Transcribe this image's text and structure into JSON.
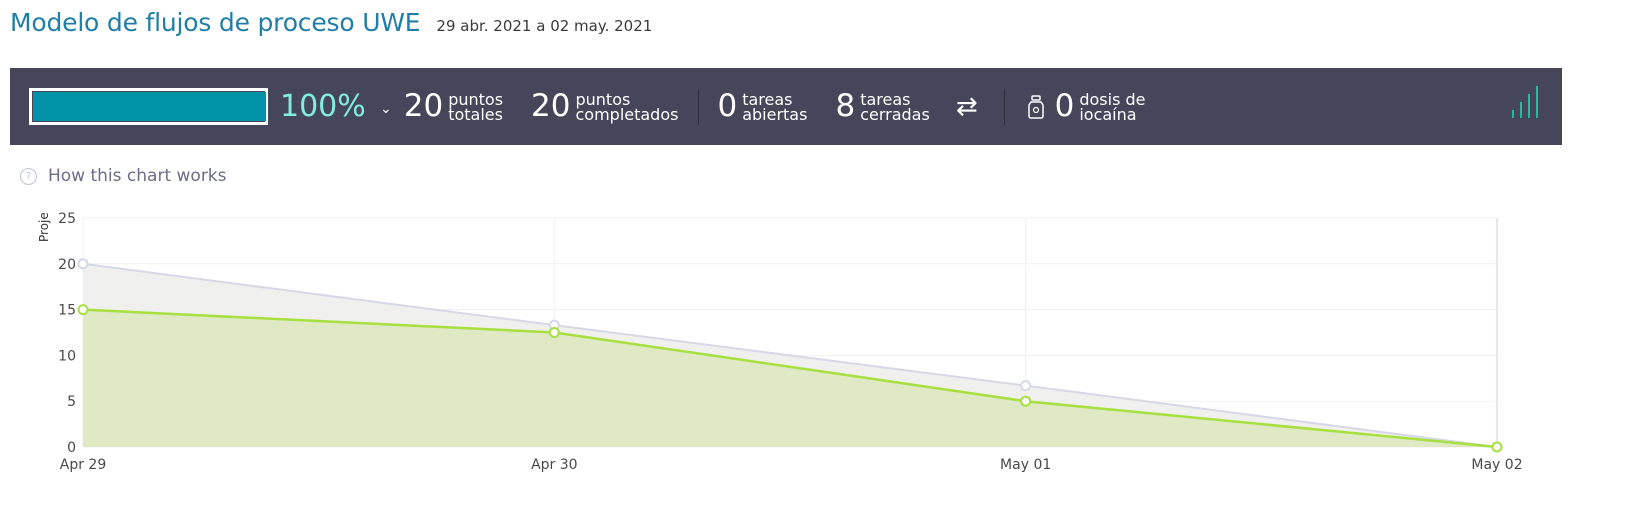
{
  "header": {
    "title": "Modelo de flujos de proceso UWE",
    "date_range": "29 abr. 2021 a 02 may. 2021"
  },
  "stats": {
    "progress_fraction": 1.0,
    "percent": "100%",
    "total_points": "20",
    "total_label_1": "puntos",
    "total_label_2": "totales",
    "completed_points": "20",
    "completed_label_1": "puntos",
    "completed_label_2": "completados",
    "open_tasks": "0",
    "open_label_1": "tareas",
    "open_label_2": "abiertas",
    "closed_tasks": "8",
    "closed_label_1": "tareas",
    "closed_label_2": "cerradas",
    "iocaine": "0",
    "iocaine_label_1": "dosis de",
    "iocaine_label_2": "iocaína",
    "accent_color": "#0092a6",
    "percent_color": "#83eedf",
    "bar_bg": "#45465a",
    "icons": [
      "chevron-down-icon",
      "swap-arrows-icon",
      "iocaine-jar-icon",
      "signal-bars-icon"
    ]
  },
  "help": {
    "text": "How this chart works"
  },
  "chart_data": {
    "type": "area",
    "ylabel": "Proje",
    "x": [
      "Apr 29",
      "Apr 30",
      "May 01",
      "May 02"
    ],
    "ylim": [
      0,
      25
    ],
    "yticks": [
      0,
      5,
      10,
      15,
      20,
      25
    ],
    "grid": true,
    "series": [
      {
        "values": [
          20,
          13.3,
          6.7,
          0
        ],
        "color": "#d5d9e6",
        "fill": "#f0f0ef"
      },
      {
        "values": [
          15,
          12.5,
          5,
          0
        ],
        "color": "#a7e03f",
        "fill": "#dfe9c4"
      }
    ]
  }
}
